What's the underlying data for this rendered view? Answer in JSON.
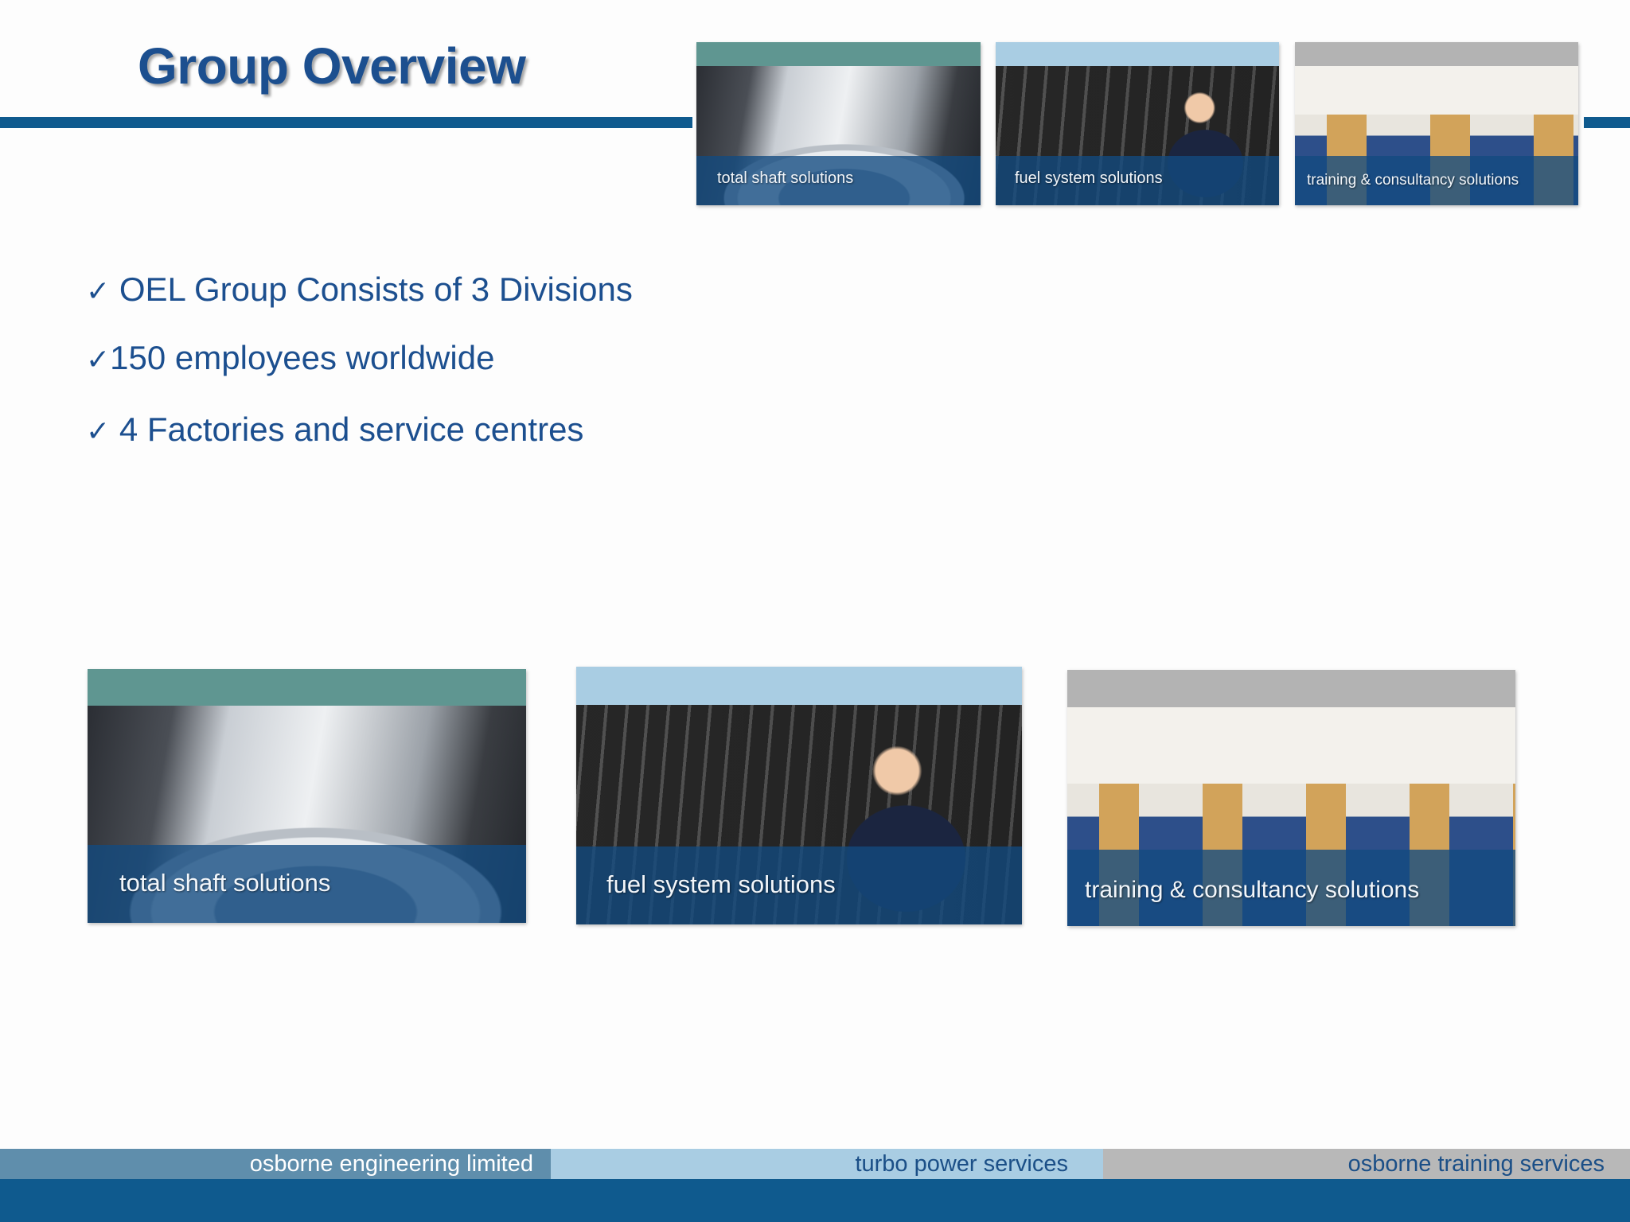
{
  "slide": {
    "title": "Group Overview"
  },
  "header_tiles": [
    {
      "caption": "total shaft solutions",
      "band_color": "#5f9691"
    },
    {
      "caption": "fuel system solutions",
      "band_color": "#a9cde3"
    },
    {
      "caption": "training & consultancy solutions",
      "band_color": "#b3b3b3"
    }
  ],
  "bullets": [
    {
      "check": "✓",
      "text": " OEL Group Consists of 3 Divisions"
    },
    {
      "check": "✓",
      "text": "150 employees worldwide"
    },
    {
      "check": "✓",
      "text": " 4 Factories and service centres"
    }
  ],
  "division_tiles": [
    {
      "caption": "total shaft solutions",
      "band_color": "#5f9691"
    },
    {
      "caption": "fuel system solutions",
      "band_color": "#a9cde3"
    },
    {
      "caption": "training & consultancy solutions",
      "band_color": "#b3b3b3"
    }
  ],
  "footer": {
    "segments": [
      "osborne engineering limited",
      "turbo power services",
      "osborne training services"
    ],
    "bar_color": "#0f5a8e"
  }
}
